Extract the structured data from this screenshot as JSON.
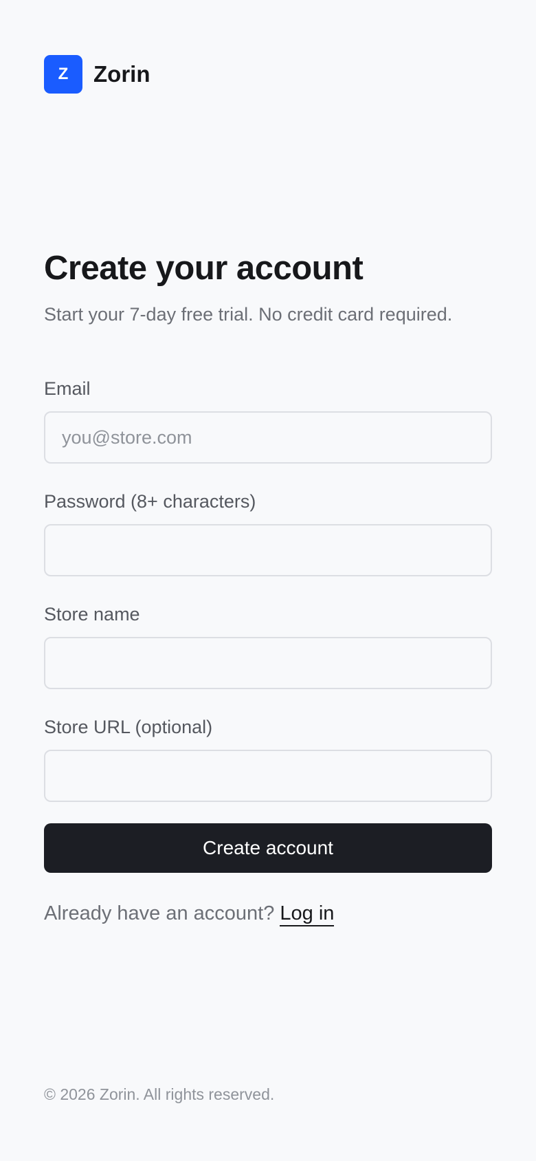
{
  "brand": {
    "logo_letter": "Z",
    "name": "Zorin",
    "color": "#1a5cff"
  },
  "header": {
    "title": "Create your account",
    "subtitle": "Start your 7-day free trial. No credit card required."
  },
  "form": {
    "email": {
      "label": "Email",
      "placeholder": "you@store.com",
      "value": ""
    },
    "password": {
      "label": "Password (8+ characters)",
      "placeholder": "",
      "value": ""
    },
    "store_name": {
      "label": "Store name",
      "placeholder": "",
      "value": ""
    },
    "store_url": {
      "label": "Store URL (optional)",
      "placeholder": "",
      "value": ""
    },
    "submit_label": "Create account"
  },
  "login": {
    "prompt": "Already have an account?",
    "link_label": "Log in"
  },
  "footer": {
    "copyright": "© 2026 Zorin. All rights reserved."
  }
}
